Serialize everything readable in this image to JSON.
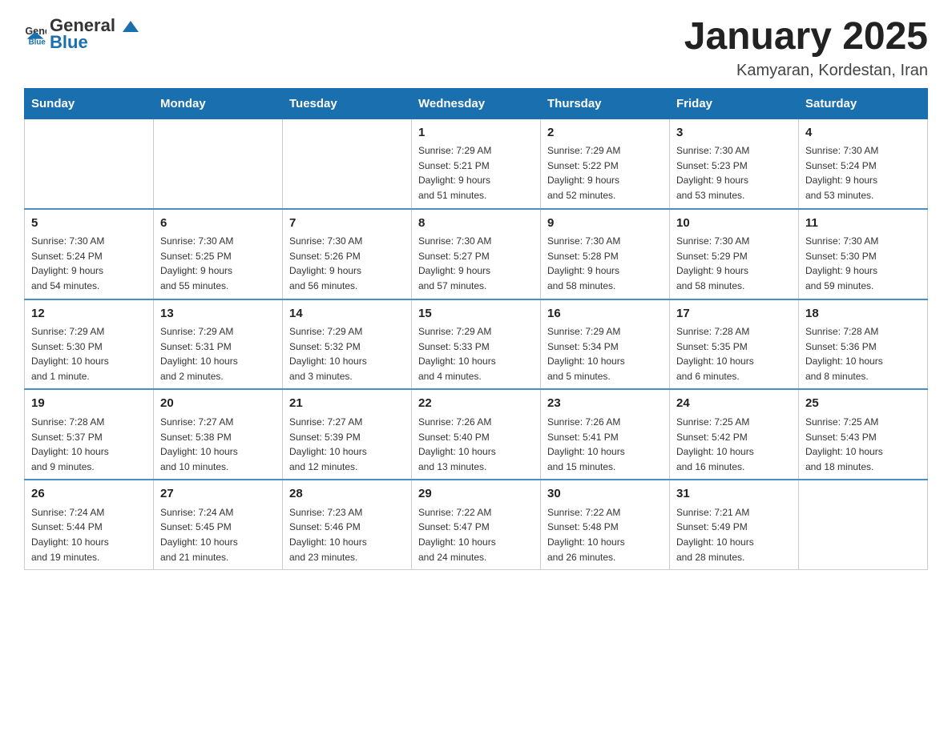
{
  "header": {
    "logo": {
      "general": "General",
      "blue": "Blue"
    },
    "title": "January 2025",
    "location": "Kamyaran, Kordestan, Iran"
  },
  "days_of_week": [
    "Sunday",
    "Monday",
    "Tuesday",
    "Wednesday",
    "Thursday",
    "Friday",
    "Saturday"
  ],
  "weeks": [
    {
      "days": [
        {
          "date": "",
          "info": ""
        },
        {
          "date": "",
          "info": ""
        },
        {
          "date": "",
          "info": ""
        },
        {
          "date": "1",
          "info": "Sunrise: 7:29 AM\nSunset: 5:21 PM\nDaylight: 9 hours\nand 51 minutes."
        },
        {
          "date": "2",
          "info": "Sunrise: 7:29 AM\nSunset: 5:22 PM\nDaylight: 9 hours\nand 52 minutes."
        },
        {
          "date": "3",
          "info": "Sunrise: 7:30 AM\nSunset: 5:23 PM\nDaylight: 9 hours\nand 53 minutes."
        },
        {
          "date": "4",
          "info": "Sunrise: 7:30 AM\nSunset: 5:24 PM\nDaylight: 9 hours\nand 53 minutes."
        }
      ]
    },
    {
      "days": [
        {
          "date": "5",
          "info": "Sunrise: 7:30 AM\nSunset: 5:24 PM\nDaylight: 9 hours\nand 54 minutes."
        },
        {
          "date": "6",
          "info": "Sunrise: 7:30 AM\nSunset: 5:25 PM\nDaylight: 9 hours\nand 55 minutes."
        },
        {
          "date": "7",
          "info": "Sunrise: 7:30 AM\nSunset: 5:26 PM\nDaylight: 9 hours\nand 56 minutes."
        },
        {
          "date": "8",
          "info": "Sunrise: 7:30 AM\nSunset: 5:27 PM\nDaylight: 9 hours\nand 57 minutes."
        },
        {
          "date": "9",
          "info": "Sunrise: 7:30 AM\nSunset: 5:28 PM\nDaylight: 9 hours\nand 58 minutes."
        },
        {
          "date": "10",
          "info": "Sunrise: 7:30 AM\nSunset: 5:29 PM\nDaylight: 9 hours\nand 58 minutes."
        },
        {
          "date": "11",
          "info": "Sunrise: 7:30 AM\nSunset: 5:30 PM\nDaylight: 9 hours\nand 59 minutes."
        }
      ]
    },
    {
      "days": [
        {
          "date": "12",
          "info": "Sunrise: 7:29 AM\nSunset: 5:30 PM\nDaylight: 10 hours\nand 1 minute."
        },
        {
          "date": "13",
          "info": "Sunrise: 7:29 AM\nSunset: 5:31 PM\nDaylight: 10 hours\nand 2 minutes."
        },
        {
          "date": "14",
          "info": "Sunrise: 7:29 AM\nSunset: 5:32 PM\nDaylight: 10 hours\nand 3 minutes."
        },
        {
          "date": "15",
          "info": "Sunrise: 7:29 AM\nSunset: 5:33 PM\nDaylight: 10 hours\nand 4 minutes."
        },
        {
          "date": "16",
          "info": "Sunrise: 7:29 AM\nSunset: 5:34 PM\nDaylight: 10 hours\nand 5 minutes."
        },
        {
          "date": "17",
          "info": "Sunrise: 7:28 AM\nSunset: 5:35 PM\nDaylight: 10 hours\nand 6 minutes."
        },
        {
          "date": "18",
          "info": "Sunrise: 7:28 AM\nSunset: 5:36 PM\nDaylight: 10 hours\nand 8 minutes."
        }
      ]
    },
    {
      "days": [
        {
          "date": "19",
          "info": "Sunrise: 7:28 AM\nSunset: 5:37 PM\nDaylight: 10 hours\nand 9 minutes."
        },
        {
          "date": "20",
          "info": "Sunrise: 7:27 AM\nSunset: 5:38 PM\nDaylight: 10 hours\nand 10 minutes."
        },
        {
          "date": "21",
          "info": "Sunrise: 7:27 AM\nSunset: 5:39 PM\nDaylight: 10 hours\nand 12 minutes."
        },
        {
          "date": "22",
          "info": "Sunrise: 7:26 AM\nSunset: 5:40 PM\nDaylight: 10 hours\nand 13 minutes."
        },
        {
          "date": "23",
          "info": "Sunrise: 7:26 AM\nSunset: 5:41 PM\nDaylight: 10 hours\nand 15 minutes."
        },
        {
          "date": "24",
          "info": "Sunrise: 7:25 AM\nSunset: 5:42 PM\nDaylight: 10 hours\nand 16 minutes."
        },
        {
          "date": "25",
          "info": "Sunrise: 7:25 AM\nSunset: 5:43 PM\nDaylight: 10 hours\nand 18 minutes."
        }
      ]
    },
    {
      "days": [
        {
          "date": "26",
          "info": "Sunrise: 7:24 AM\nSunset: 5:44 PM\nDaylight: 10 hours\nand 19 minutes."
        },
        {
          "date": "27",
          "info": "Sunrise: 7:24 AM\nSunset: 5:45 PM\nDaylight: 10 hours\nand 21 minutes."
        },
        {
          "date": "28",
          "info": "Sunrise: 7:23 AM\nSunset: 5:46 PM\nDaylight: 10 hours\nand 23 minutes."
        },
        {
          "date": "29",
          "info": "Sunrise: 7:22 AM\nSunset: 5:47 PM\nDaylight: 10 hours\nand 24 minutes."
        },
        {
          "date": "30",
          "info": "Sunrise: 7:22 AM\nSunset: 5:48 PM\nDaylight: 10 hours\nand 26 minutes."
        },
        {
          "date": "31",
          "info": "Sunrise: 7:21 AM\nSunset: 5:49 PM\nDaylight: 10 hours\nand 28 minutes."
        },
        {
          "date": "",
          "info": ""
        }
      ]
    }
  ]
}
